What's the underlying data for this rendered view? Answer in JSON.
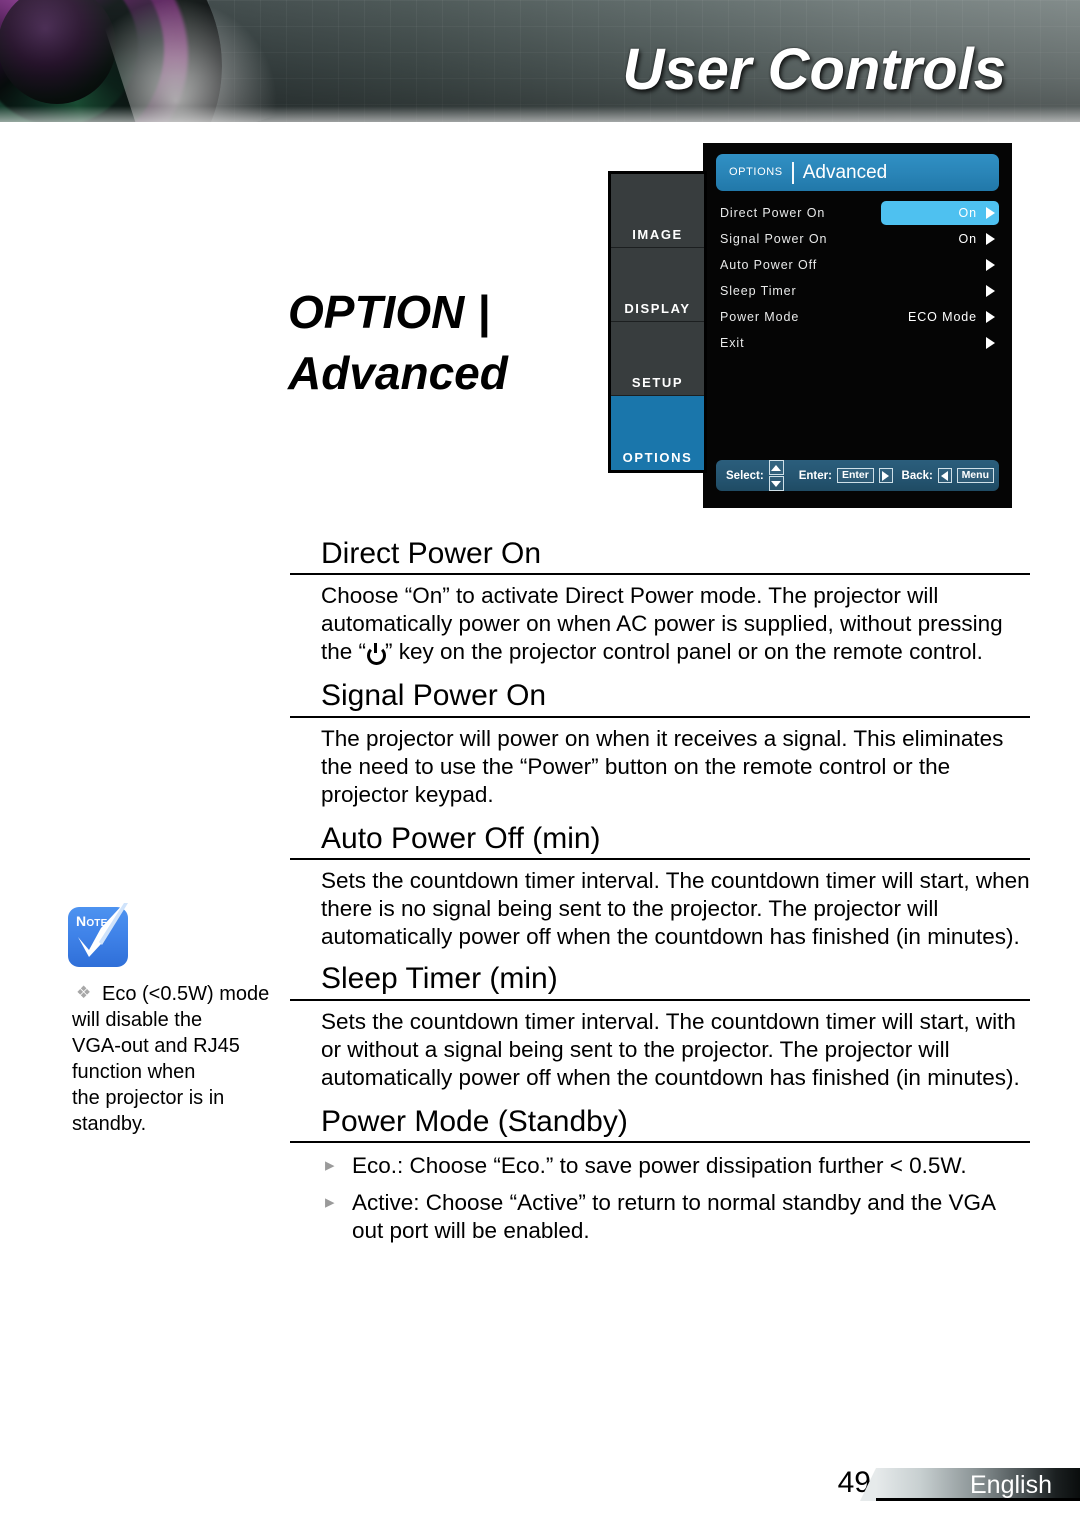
{
  "header": {
    "title": "User Controls",
    "lens_icon": "camera-lens-graphic"
  },
  "page_title": "OPTION |\nAdvanced",
  "osd": {
    "sidebar_tabs": [
      {
        "label": "IMAGE",
        "active": false
      },
      {
        "label": "DISPLAY",
        "active": false
      },
      {
        "label": "SETUP",
        "active": false
      },
      {
        "label": "OPTIONS",
        "active": true
      }
    ],
    "titlebar": {
      "category": "OPTIONS",
      "name": "Advanced"
    },
    "rows": [
      {
        "label": "Direct Power On",
        "value": "On",
        "selected": true
      },
      {
        "label": "Signal Power On",
        "value": "On",
        "selected": false
      },
      {
        "label": "Auto Power Off",
        "value": "",
        "selected": false
      },
      {
        "label": "Sleep Timer",
        "value": "",
        "selected": false
      },
      {
        "label": "Power Mode",
        "value": "ECO Mode",
        "selected": false
      },
      {
        "label": "Exit",
        "value": "",
        "selected": false
      }
    ],
    "footer": {
      "select_label": "Select:",
      "enter_label": "Enter:",
      "enter_key": "Enter",
      "back_label": "Back:",
      "menu_key": "Menu"
    },
    "colors": {
      "titlebar_blue": "#2a85b8",
      "selected_blue": "#4ec1f0",
      "active_tab_blue": "#1a76ab",
      "tab_gray": "#383d3e",
      "panel_black": "#050505",
      "footer_blue": "#255571"
    }
  },
  "sections": [
    {
      "heading": "Direct Power On",
      "paragraphs": [
        "Choose “On” to activate Direct Power mode. The projector will automatically power on when AC power is supplied, without pressing the “",
        "” key on the projector control panel or on the remote control."
      ],
      "has_power_glyph": true
    },
    {
      "heading": "Signal Power On",
      "paragraphs": [
        "The projector will power on when it receives a signal. This eliminates the need to use the “Power” button on the remote control or the projector keypad."
      ],
      "has_power_glyph": false
    },
    {
      "heading": "Auto Power Off (min)",
      "paragraphs": [
        "Sets the countdown timer interval. The countdown timer will start, when there is no signal being sent to the projector. The projector will automatically power off when the countdown has finished (in minutes)."
      ],
      "has_power_glyph": false
    },
    {
      "heading": "Sleep Timer (min)",
      "paragraphs": [
        "Sets the countdown timer interval. The countdown timer will start, with or without a signal being sent to the projector. The projector will automatically power off when the countdown has finished (in minutes)."
      ],
      "has_power_glyph": false
    },
    {
      "heading": "Power Mode (Standby)",
      "bullets": [
        "Eco.: Choose “Eco.” to save power dissipation further < 0.5W.",
        "Active: Choose “Active” to return to normal standby and the VGA out port will be enabled."
      ],
      "bullet_marker": "▸",
      "has_power_glyph": false
    }
  ],
  "note": {
    "icon_label": "NOTE",
    "icon_label_first": "N",
    "icon_label_rest": "OTE",
    "marker": "❖",
    "text": "Eco (<0.5W) mode\nwill disable  the\nVGA-out and RJ45\nfunction when\nthe projector is in\nstandby."
  },
  "footer": {
    "page_number": "49",
    "language": "English"
  }
}
